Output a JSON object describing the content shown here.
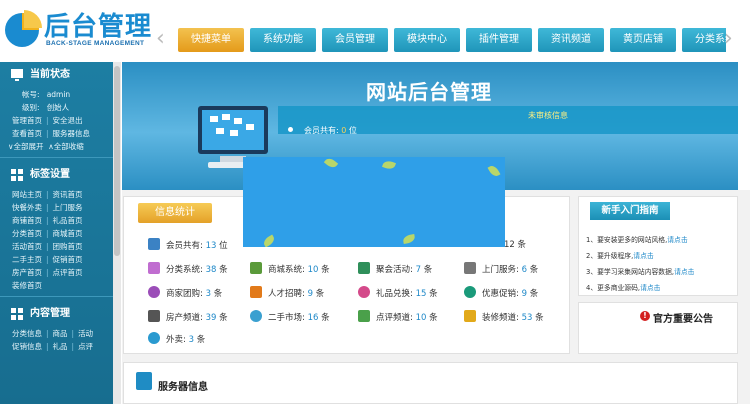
{
  "logo": {
    "title": "后台管理",
    "subtitle": "BACK-STAGE MANAGEMENT"
  },
  "nav": {
    "prev": "‹",
    "next": "›",
    "tabs": [
      "快捷菜单",
      "系统功能",
      "会员管理",
      "模块中心",
      "插件管理",
      "资讯频道",
      "黄页店铺",
      "分类系统"
    ]
  },
  "sidebar": {
    "status_title": "当前状态",
    "account_label": "帐号:",
    "account_value": "admin",
    "level_label": "级别:",
    "level_value": "创始人",
    "rows_status": [
      [
        "管理首页",
        "安全退出"
      ],
      [
        "查看首页",
        "服务器信息"
      ],
      [
        "∨全部展开",
        "∧全部收缩"
      ]
    ],
    "tags_title": "标签设置",
    "rows_tags": [
      [
        "网站主页",
        "资讯首页"
      ],
      [
        "快餐外卖",
        "上门服务"
      ],
      [
        "商铺首页",
        "礼品首页"
      ],
      [
        "分类首页",
        "商城首页"
      ],
      [
        "活动首页",
        "团购首页"
      ],
      [
        "二手主页",
        "促销首页"
      ],
      [
        "房产首页",
        "点评首页"
      ],
      [
        "装修首页"
      ]
    ],
    "content_title": "内容管理",
    "rows_content": [
      [
        "分类信息",
        "商品",
        "活动"
      ],
      [
        "促销信息",
        "礼品",
        "点评"
      ]
    ]
  },
  "banner": {
    "title": "网站后台管理",
    "notice_title": "未审核信息",
    "notice_text_prefix": "会员共有:",
    "notice_count": "0",
    "notice_unit": "位"
  },
  "stats": {
    "tab": "信息统计",
    "items": [
      {
        "label": "会员共有:",
        "value": "13",
        "unit": "位",
        "color": "#3b82c4"
      },
      {
        "label": "分类系统:",
        "value": "38",
        "unit": "条",
        "color": "#c06dd0"
      },
      {
        "label": "商城系统:",
        "value": "10",
        "unit": "条",
        "color": "#5a9a3a"
      },
      {
        "label": "聚会活动:",
        "value": "7",
        "unit": "条",
        "color": "#2f8f5a"
      },
      {
        "label": "上门服务:",
        "value": "6",
        "unit": "条",
        "color": "#777777"
      },
      {
        "label": "商家团购:",
        "value": "3",
        "unit": "条",
        "color": "#9b4db8"
      },
      {
        "label": "人才招聘:",
        "value": "9",
        "unit": "条",
        "color": "#e27a1a"
      },
      {
        "label": "礼品兑换:",
        "value": "15",
        "unit": "条",
        "color": "#d44a8a"
      },
      {
        "label": "优惠促销:",
        "value": "9",
        "unit": "条",
        "color": "#1a9a7a"
      },
      {
        "label": "房产频道:",
        "value": "39",
        "unit": "条",
        "color": "#555555"
      },
      {
        "label": "二手市场:",
        "value": "16",
        "unit": "条",
        "color": "#3aa0d0"
      },
      {
        "label": "点评频道:",
        "value": "10",
        "unit": "条",
        "color": "#4aa04a"
      },
      {
        "label": "装修频道:",
        "value": "53",
        "unit": "条",
        "color": "#e2a91a"
      },
      {
        "label": "外卖:",
        "value": "3",
        "unit": "条",
        "color": "#2a9ad0"
      }
    ],
    "partial_items": [
      {
        "value": "12",
        "unit": "条"
      }
    ]
  },
  "guide": {
    "title": "新手入门指南",
    "items": [
      {
        "text": "1、要安装更多的网站风格,",
        "link": "请点击"
      },
      {
        "text": "2、要升级程序,",
        "link": "请点击"
      },
      {
        "text": "3、要学习采集网站内容数据,",
        "link": "请点击"
      },
      {
        "text": "4、更多商业源码,",
        "link": "请点击"
      }
    ]
  },
  "announce": {
    "icon": "!",
    "title": "官方重要公告"
  },
  "server": {
    "title": "服务器信息"
  }
}
